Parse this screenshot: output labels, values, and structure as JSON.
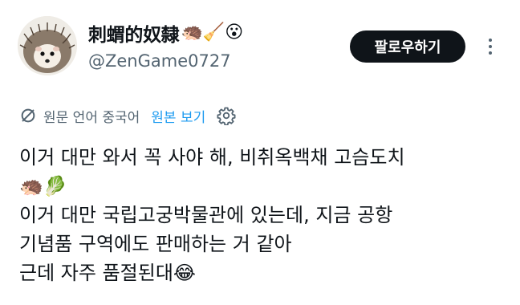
{
  "author": {
    "display_name": "刺蝟的奴隸",
    "display_name_emoji": "🦔🧹😮",
    "handle": "@ZenGame0727"
  },
  "actions": {
    "follow_label": "팔로우하기"
  },
  "translation": {
    "source_language_label": "원문 언어 중국어",
    "show_original_label": "원본 보기"
  },
  "tweet": {
    "lines": [
      "이거 대만 와서 꼭 사야 해, 비취옥백채 고슴도치",
      "🦔🥬",
      "이거 대만 국립고궁박물관에 있는데, 지금 공항",
      "기념품 구역에도 판매하는 거 같아",
      "근데 자주 품절된대😂"
    ]
  },
  "colors": {
    "text_primary": "#0f1419",
    "text_secondary": "#536471",
    "link_blue": "#1d9bf0",
    "follow_button_bg": "#0f1419"
  }
}
